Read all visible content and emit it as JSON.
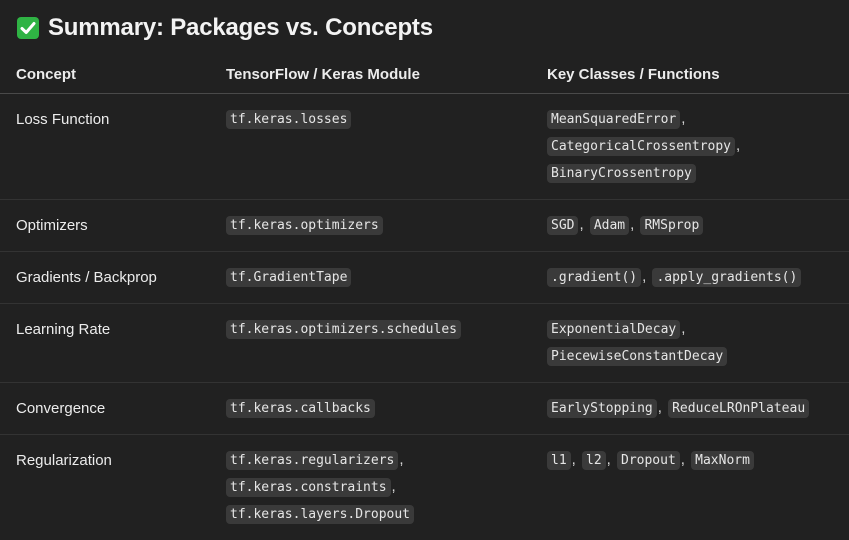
{
  "heading": {
    "icon": "check-mark-button-icon",
    "icon_color": "#2fb344",
    "text": "Summary: Packages vs. Concepts"
  },
  "table": {
    "headers": [
      "Concept",
      "TensorFlow / Keras Module",
      "Key Classes / Functions"
    ],
    "rows": [
      {
        "concept": "Loss Function",
        "modules": [
          "tf.keras.losses"
        ],
        "functions": [
          "MeanSquaredError",
          "CategoricalCrossentropy",
          "BinaryCrossentropy"
        ]
      },
      {
        "concept": "Optimizers",
        "modules": [
          "tf.keras.optimizers"
        ],
        "functions": [
          "SGD",
          "Adam",
          "RMSprop"
        ]
      },
      {
        "concept": "Gradients / Backprop",
        "modules": [
          "tf.GradientTape"
        ],
        "functions": [
          ".gradient()",
          ".apply_gradients()"
        ]
      },
      {
        "concept": "Learning Rate",
        "modules": [
          "tf.keras.optimizers.schedules"
        ],
        "functions": [
          "ExponentialDecay",
          "PiecewiseConstantDecay"
        ]
      },
      {
        "concept": "Convergence",
        "modules": [
          "tf.keras.callbacks"
        ],
        "functions": [
          "EarlyStopping",
          "ReduceLROnPlateau"
        ]
      },
      {
        "concept": "Regularization",
        "modules": [
          "tf.keras.regularizers",
          "tf.keras.constraints",
          "tf.keras.layers.Dropout"
        ],
        "functions": [
          "l1",
          "l2",
          "Dropout",
          "MaxNorm"
        ]
      }
    ]
  }
}
